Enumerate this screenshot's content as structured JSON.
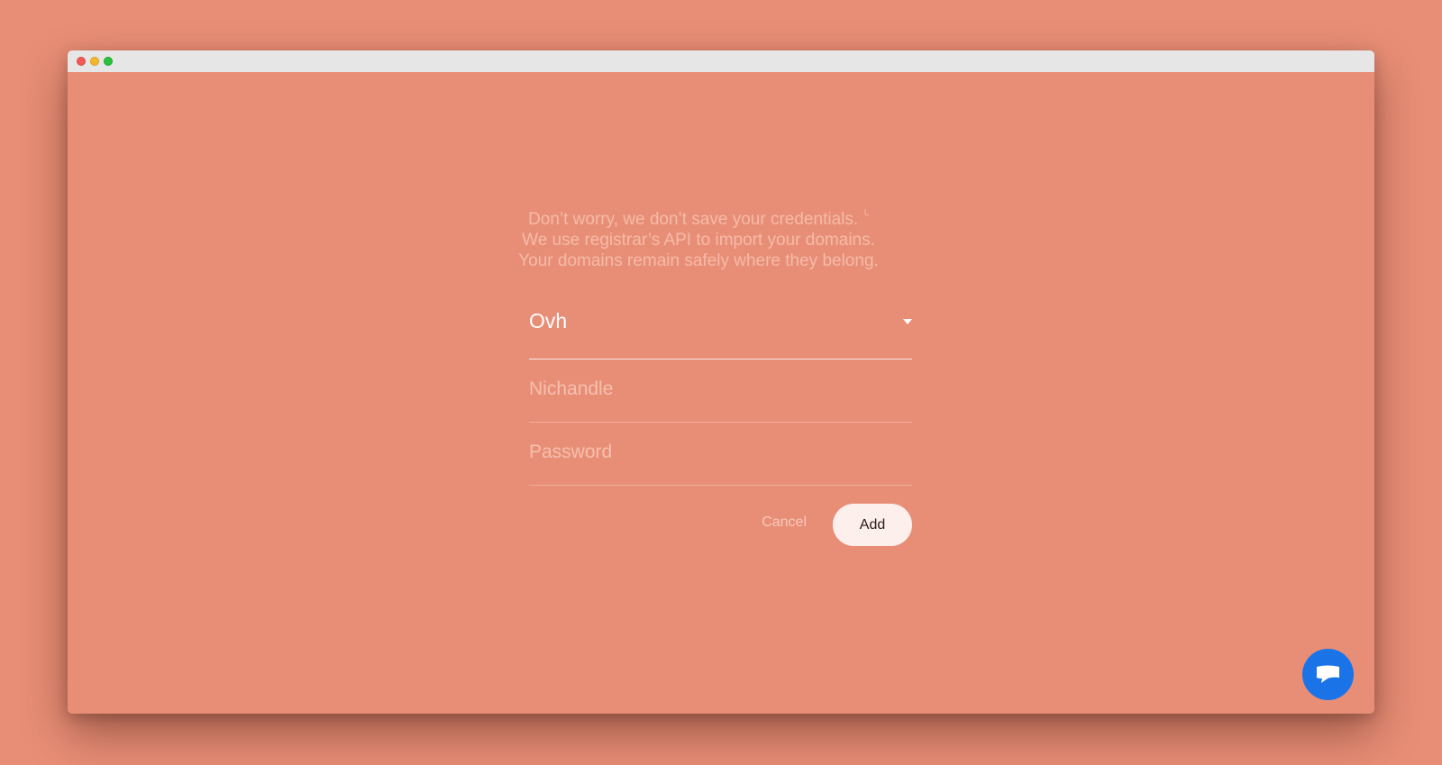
{
  "info": {
    "line1": "Don’t worry, we don’t save your credentials.",
    "line2": "We use registrar’s API to import your domains.",
    "line3": "Your domains remain safely where they belong."
  },
  "form": {
    "registrar": {
      "selected": "Ovh"
    },
    "nichandle": {
      "value": "",
      "placeholder": "Nichandle"
    },
    "password": {
      "value": "",
      "placeholder": "Password"
    }
  },
  "actions": {
    "cancel_label": "Cancel",
    "add_label": "Add"
  },
  "icons": {
    "registrar_dropdown": "caret-down-icon",
    "chat": "chat-bubble-icon"
  },
  "colors": {
    "background": "#e98e76",
    "titlebar": "#e6e6e6",
    "add_button_bg": "#fdf0ec",
    "chat_button": "#1b73e8"
  }
}
